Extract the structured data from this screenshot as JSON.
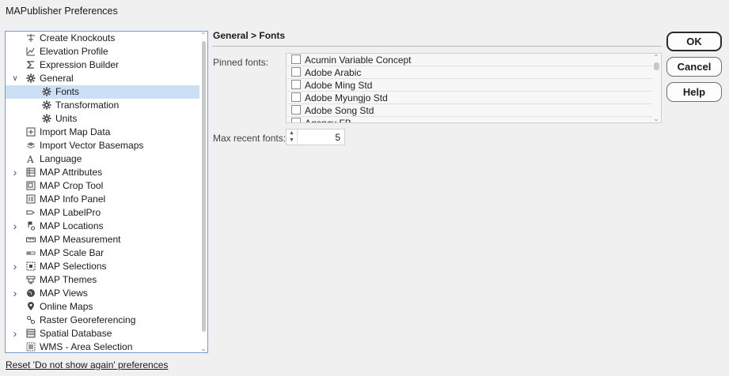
{
  "window": {
    "title": "MAPublisher Preferences"
  },
  "tree": {
    "items": [
      {
        "label": "Create Knockouts",
        "icon": "knockout-icon",
        "expandable": false,
        "indent": 0
      },
      {
        "label": "Elevation Profile",
        "icon": "elevation-profile-icon",
        "expandable": false,
        "indent": 0
      },
      {
        "label": "Expression Builder",
        "icon": "sigma-icon",
        "expandable": false,
        "indent": 0
      },
      {
        "label": "General",
        "icon": "gear-icon",
        "expandable": true,
        "expanded": true,
        "indent": 0
      },
      {
        "label": "Fonts",
        "icon": "gear-icon",
        "expandable": false,
        "indent": 1,
        "selected": true
      },
      {
        "label": "Transformation",
        "icon": "gear-icon",
        "expandable": false,
        "indent": 1
      },
      {
        "label": "Units",
        "icon": "gear-icon",
        "expandable": false,
        "indent": 1
      },
      {
        "label": "Import Map Data",
        "icon": "import-map-data-icon",
        "expandable": false,
        "indent": 0
      },
      {
        "label": "Import Vector Basemaps",
        "icon": "layers-icon",
        "expandable": false,
        "indent": 0
      },
      {
        "label": "Language",
        "icon": "language-icon",
        "expandable": false,
        "indent": 0
      },
      {
        "label": "MAP Attributes",
        "icon": "table-icon",
        "expandable": true,
        "indent": 0
      },
      {
        "label": "MAP Crop Tool",
        "icon": "crop-icon",
        "expandable": false,
        "indent": 0
      },
      {
        "label": "MAP Info Panel",
        "icon": "info-panel-icon",
        "expandable": false,
        "indent": 0
      },
      {
        "label": "MAP LabelPro",
        "icon": "labelpro-icon",
        "expandable": false,
        "indent": 0
      },
      {
        "label": "MAP Locations",
        "icon": "locations-icon",
        "expandable": true,
        "indent": 0
      },
      {
        "label": "MAP Measurement",
        "icon": "ruler-icon",
        "expandable": false,
        "indent": 0
      },
      {
        "label": "MAP Scale Bar",
        "icon": "scale-bar-icon",
        "expandable": false,
        "indent": 0
      },
      {
        "label": "MAP Selections",
        "icon": "selection-icon",
        "expandable": true,
        "indent": 0
      },
      {
        "label": "MAP Themes",
        "icon": "themes-icon",
        "expandable": false,
        "indent": 0
      },
      {
        "label": "MAP Views",
        "icon": "globe-icon",
        "expandable": true,
        "indent": 0
      },
      {
        "label": "Online Maps",
        "icon": "map-pin-icon",
        "expandable": false,
        "indent": 0
      },
      {
        "label": "Raster Georeferencing",
        "icon": "georeference-icon",
        "expandable": false,
        "indent": 0
      },
      {
        "label": "Spatial Database",
        "icon": "database-icon",
        "expandable": true,
        "indent": 0
      },
      {
        "label": "WMS - Area Selection",
        "icon": "area-selection-icon",
        "expandable": false,
        "indent": 0
      }
    ]
  },
  "panel": {
    "heading": "General > Fonts",
    "pinned_label": "Pinned fonts:",
    "fonts": [
      {
        "name": "Acumin Variable Concept",
        "checked": false
      },
      {
        "name": "Adobe Arabic",
        "checked": false
      },
      {
        "name": "Adobe Ming Std",
        "checked": false
      },
      {
        "name": "Adobe Myungjo Std",
        "checked": false
      },
      {
        "name": "Adobe Song Std",
        "checked": false
      },
      {
        "name": "Agency FB",
        "checked": false
      }
    ],
    "max_recent_label": "Max recent fonts:",
    "max_recent_value": "5"
  },
  "buttons": {
    "ok": "OK",
    "cancel": "Cancel",
    "help": "Help"
  },
  "footer": {
    "reset_link": "Reset 'Do not show again' preferences"
  },
  "colors": {
    "selection": "#cce0f5",
    "tree_border": "#7a9cc9",
    "background": "#f0f0f0"
  }
}
